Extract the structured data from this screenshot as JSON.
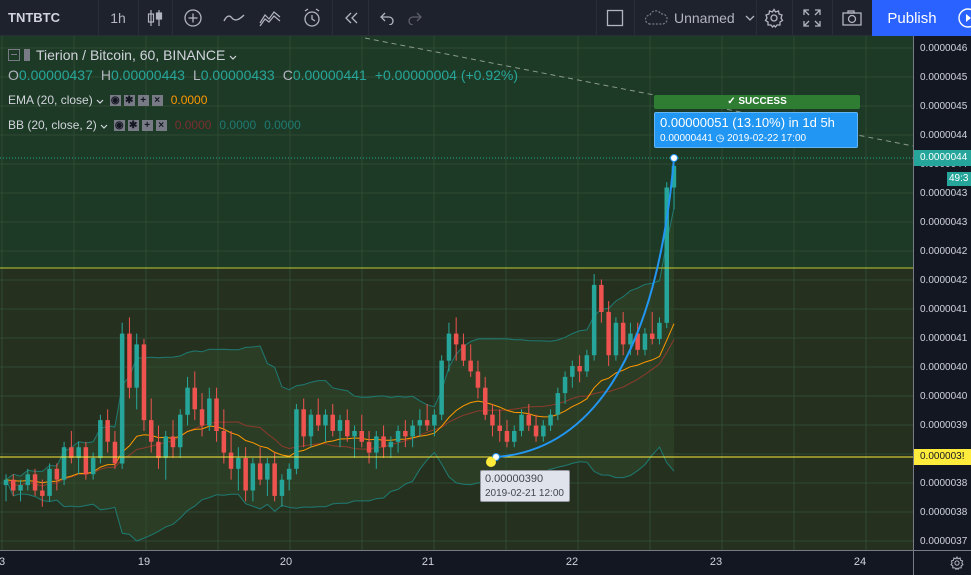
{
  "toolbar": {
    "symbol": "TNTBTC",
    "interval": "1h",
    "layout_name": "Unnamed",
    "publish_label": "Publish",
    "icons": [
      "candles-icon",
      "add-indicator-icon",
      "indicators-icon",
      "compare-icon",
      "alert-icon",
      "replay-icon",
      "undo-icon",
      "redo-icon",
      "layout-icon",
      "cloud-icon",
      "settings-icon",
      "fullscreen-icon",
      "snapshot-icon",
      "play-icon"
    ]
  },
  "legend": {
    "title": "Tierion / Bitcoin, 60, BINANCE",
    "open_label": "O",
    "open": "0.00000437",
    "high_label": "H",
    "high": "0.00000443",
    "low_label": "L",
    "low": "0.00000433",
    "close_label": "C",
    "close": "0.00000441",
    "change": "+0.00000004 (+0.92%)",
    "ema_label": "EMA (20, close)",
    "ema_value": "0.0000",
    "bb_label": "BB (20, close, 2)",
    "bb_value1": "0.0000",
    "bb_value2": "0.0000",
    "bb_value3": "0.0000"
  },
  "price_scale": {
    "ticks": [
      "0.0000046",
      "0.0000045",
      "0.0000045",
      "0.0000044",
      "0.0000044",
      "0.0000043",
      "0.0000043",
      "0.0000042",
      "0.0000042",
      "0.0000041",
      "0.0000041",
      "0.0000040",
      "0.0000040",
      "0.0000039",
      "0.0000039",
      "0.0000038",
      "0.0000038",
      "0.0000037"
    ],
    "current_price_label": "0.0000044",
    "countdown": "49:3",
    "horizontal_line_label": "0.000003!"
  },
  "time_scale": {
    "ticks": [
      "3",
      "19",
      "20",
      "21",
      "22",
      "23",
      "24"
    ]
  },
  "annotations": {
    "success": "✓ SUCCESS",
    "target_line1": "0.00000051 (13.10%) in 1d 5h",
    "target_line2": "0.00000441   ◷ 2019-02-22  17:00",
    "start_price": "0.00000390",
    "start_time": "2019-02-21 12:00"
  },
  "colors": {
    "up": "#26a69a",
    "down": "#ef5350",
    "ema": "#ff9800",
    "bb_band": "#1e7a72",
    "forecast": "#2196f3",
    "hline": "#ffeb3b",
    "publish": "#2962ff"
  },
  "chart_data": {
    "type": "candlestick",
    "symbol": "Tierion / Bitcoin, 60, BINANCE",
    "x_axis": "hourly candles, 2019-02-18 to 2019-02-22",
    "ylim": [
      3.7e-06,
      4.65e-06
    ],
    "candles": [
      [
        3.82e-06,
        3.84e-06,
        3.79e-06,
        3.83e-06
      ],
      [
        3.83e-06,
        3.84e-06,
        3.8e-06,
        3.81e-06
      ],
      [
        3.81e-06,
        3.83e-06,
        3.79e-06,
        3.82e-06
      ],
      [
        3.82e-06,
        3.85e-06,
        3.81e-06,
        3.84e-06
      ],
      [
        3.84e-06,
        3.85e-06,
        3.8e-06,
        3.81e-06
      ],
      [
        3.81e-06,
        3.83e-06,
        3.78e-06,
        3.8e-06
      ],
      [
        3.8e-06,
        3.86e-06,
        3.79e-06,
        3.85e-06
      ],
      [
        3.85e-06,
        3.86e-06,
        3.81e-06,
        3.83e-06
      ],
      [
        3.83e-06,
        3.9e-06,
        3.82e-06,
        3.89e-06
      ],
      [
        3.89e-06,
        3.92e-06,
        3.86e-06,
        3.87e-06
      ],
      [
        3.87e-06,
        3.9e-06,
        3.84e-06,
        3.89e-06
      ],
      [
        3.89e-06,
        3.9e-06,
        3.83e-06,
        3.84e-06
      ],
      [
        3.84e-06,
        3.88e-06,
        3.83e-06,
        3.87e-06
      ],
      [
        3.87e-06,
        3.95e-06,
        3.86e-06,
        3.94e-06
      ],
      [
        3.94e-06,
        3.96e-06,
        3.88e-06,
        3.9e-06
      ],
      [
        3.9e-06,
        3.92e-06,
        3.85e-06,
        3.86e-06
      ],
      [
        3.86e-06,
        4.12e-06,
        3.85e-06,
        4.1e-06
      ],
      [
        4.1e-06,
        4.13e-06,
        3.98e-06,
        4e-06
      ],
      [
        4e-06,
        4.1e-06,
        3.96e-06,
        4.08e-06
      ],
      [
        4.08e-06,
        4.09e-06,
        3.92e-06,
        3.94e-06
      ],
      [
        3.94e-06,
        3.98e-06,
        3.88e-06,
        3.9e-06
      ],
      [
        3.9e-06,
        3.93e-06,
        3.85e-06,
        3.87e-06
      ],
      [
        3.87e-06,
        3.92e-06,
        3.83e-06,
        3.91e-06
      ],
      [
        3.91e-06,
        3.94e-06,
        3.87e-06,
        3.89e-06
      ],
      [
        3.89e-06,
        3.96e-06,
        3.87e-06,
        3.95e-06
      ],
      [
        3.95e-06,
        4.02e-06,
        3.93e-06,
        4e-06
      ],
      [
        4e-06,
        4.03e-06,
        3.94e-06,
        3.96e-06
      ],
      [
        3.96e-06,
        3.99e-06,
        3.91e-06,
        3.93e-06
      ],
      [
        3.93e-06,
        4e-06,
        3.92e-06,
        3.98e-06
      ],
      [
        3.98e-06,
        4e-06,
        3.9e-06,
        3.92e-06
      ],
      [
        3.92e-06,
        3.96e-06,
        3.86e-06,
        3.88e-06
      ],
      [
        3.88e-06,
        3.92e-06,
        3.83e-06,
        3.85e-06
      ],
      [
        3.85e-06,
        3.89e-06,
        3.81e-06,
        3.87e-06
      ],
      [
        3.87e-06,
        3.89e-06,
        3.79e-06,
        3.81e-06
      ],
      [
        3.81e-06,
        3.87e-06,
        3.79e-06,
        3.86e-06
      ],
      [
        3.86e-06,
        3.89e-06,
        3.82e-06,
        3.83e-06
      ],
      [
        3.83e-06,
        3.87e-06,
        3.8e-06,
        3.86e-06
      ],
      [
        3.86e-06,
        3.88e-06,
        3.79e-06,
        3.8e-06
      ],
      [
        3.8e-06,
        3.84e-06,
        3.78e-06,
        3.83e-06
      ],
      [
        3.83e-06,
        3.86e-06,
        3.81e-06,
        3.85e-06
      ],
      [
        3.85e-06,
        3.97e-06,
        3.84e-06,
        3.96e-06
      ],
      [
        3.96e-06,
        3.98e-06,
        3.89e-06,
        3.91e-06
      ],
      [
        3.91e-06,
        3.96e-06,
        3.89e-06,
        3.95e-06
      ],
      [
        3.95e-06,
        3.98e-06,
        3.92e-06,
        3.93e-06
      ],
      [
        3.93e-06,
        3.96e-06,
        3.9e-06,
        3.95e-06
      ],
      [
        3.95e-06,
        3.97e-06,
        3.91e-06,
        3.92e-06
      ],
      [
        3.92e-06,
        3.95e-06,
        3.89e-06,
        3.94e-06
      ],
      [
        3.94e-06,
        3.96e-06,
        3.9e-06,
        3.91e-06
      ],
      [
        3.91e-06,
        3.93e-06,
        3.87e-06,
        3.92e-06
      ],
      [
        3.92e-06,
        3.95e-06,
        3.89e-06,
        3.9e-06
      ],
      [
        3.9e-06,
        3.92e-06,
        3.86e-06,
        3.88e-06
      ],
      [
        3.88e-06,
        3.92e-06,
        3.85e-06,
        3.91e-06
      ],
      [
        3.91e-06,
        3.93e-06,
        3.87e-06,
        3.89e-06
      ],
      [
        3.89e-06,
        3.91e-06,
        3.87e-06,
        3.9e-06
      ],
      [
        3.9e-06,
        3.93e-06,
        3.88e-06,
        3.92e-06
      ],
      [
        3.92e-06,
        3.94e-06,
        3.89e-06,
        3.91e-06
      ],
      [
        3.91e-06,
        3.94e-06,
        3.89e-06,
        3.93e-06
      ],
      [
        3.93e-06,
        3.96e-06,
        3.91e-06,
        3.94e-06
      ],
      [
        3.94e-06,
        3.97e-06,
        3.92e-06,
        3.93e-06
      ],
      [
        3.93e-06,
        3.96e-06,
        3.91e-06,
        3.95e-06
      ],
      [
        3.95e-06,
        4.06e-06,
        3.94e-06,
        4.05e-06
      ],
      [
        4.05e-06,
        4.12e-06,
        4.03e-06,
        4.1e-06
      ],
      [
        4.1e-06,
        4.13e-06,
        4.05e-06,
        4.08e-06
      ],
      [
        4.08e-06,
        4.1e-06,
        4.04e-06,
        4.05e-06
      ],
      [
        4.05e-06,
        4.08e-06,
        4.02e-06,
        4.03e-06
      ],
      [
        4.03e-06,
        4.05e-06,
        3.98e-06,
        4e-06
      ],
      [
        4e-06,
        4.02e-06,
        3.94e-06,
        3.95e-06
      ],
      [
        3.95e-06,
        3.97e-06,
        3.91e-06,
        3.93e-06
      ],
      [
        3.93e-06,
        3.96e-06,
        3.9e-06,
        3.92e-06
      ],
      [
        3.92e-06,
        3.94e-06,
        3.89e-06,
        3.9e-06
      ],
      [
        3.9e-06,
        3.93e-06,
        3.89e-06,
        3.92e-06
      ],
      [
        3.92e-06,
        3.96e-06,
        3.91e-06,
        3.95e-06
      ],
      [
        3.95e-06,
        3.97e-06,
        3.92e-06,
        3.93e-06
      ],
      [
        3.93e-06,
        3.95e-06,
        3.9e-06,
        3.91e-06
      ],
      [
        3.91e-06,
        3.94e-06,
        3.9e-06,
        3.93e-06
      ],
      [
        3.93e-06,
        3.96e-06,
        3.92e-06,
        3.95e-06
      ],
      [
        3.95e-06,
        4e-06,
        3.94e-06,
        3.99e-06
      ],
      [
        3.99e-06,
        4.03e-06,
        3.97e-06,
        4.02e-06
      ],
      [
        4.02e-06,
        4.05e-06,
        4e-06,
        4.04e-06
      ],
      [
        4.04e-06,
        4.06e-06,
        4.01e-06,
        4.03e-06
      ],
      [
        4.03e-06,
        4.07e-06,
        4.02e-06,
        4.06e-06
      ],
      [
        4.06e-06,
        4.21e-06,
        4.05e-06,
        4.19e-06
      ],
      [
        4.19e-06,
        4.2e-06,
        4.12e-06,
        4.14e-06
      ],
      [
        4.14e-06,
        4.16e-06,
        4.04e-06,
        4.06e-06
      ],
      [
        4.06e-06,
        4.13e-06,
        4.05e-06,
        4.12e-06
      ],
      [
        4.12e-06,
        4.14e-06,
        4.06e-06,
        4.08e-06
      ],
      [
        4.08e-06,
        4.12e-06,
        4.06e-06,
        4.1e-06
      ],
      [
        4.1e-06,
        4.12e-06,
        4.06e-06,
        4.07e-06
      ],
      [
        4.07e-06,
        4.11e-06,
        4.06e-06,
        4.1e-06
      ],
      [
        4.1e-06,
        4.14e-06,
        4.08e-06,
        4.09e-06
      ],
      [
        4.09e-06,
        4.13e-06,
        4.08e-06,
        4.12e-06
      ],
      [
        4.12e-06,
        4.38e-06,
        4.11e-06,
        4.37e-06
      ],
      [
        4.37e-06,
        4.43e-06,
        4.33e-06,
        4.41e-06
      ]
    ]
  }
}
